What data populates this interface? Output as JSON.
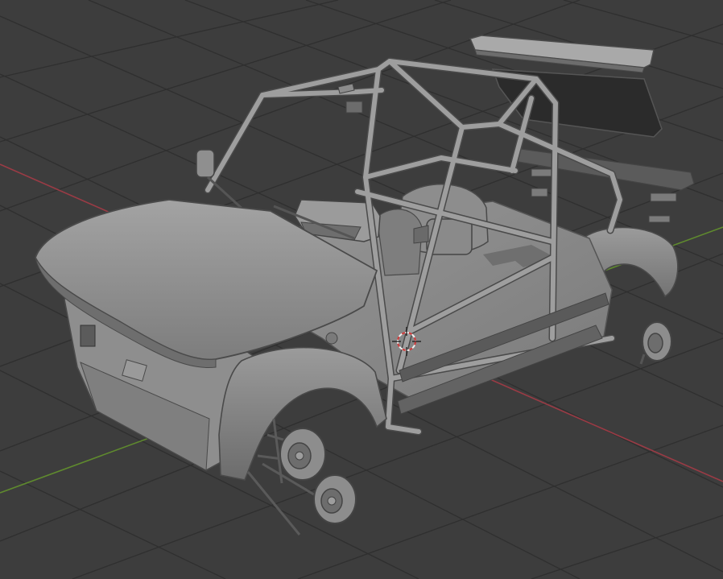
{
  "viewport": {
    "background": "#3d3d3d",
    "grid_color": "#2f2f2f",
    "x_axis_color": "#9a3b45",
    "y_axis_color": "#5f8a2e",
    "cursor_color": "#d23a3a"
  },
  "model": {
    "body_color": "#8c8c8c",
    "body_light": "#a6a6a6",
    "body_dark": "#5e5e5e",
    "wire": "#4a4a4a",
    "window_color": "#2b2b2b"
  },
  "icons": [
    "3d-cursor-icon"
  ]
}
